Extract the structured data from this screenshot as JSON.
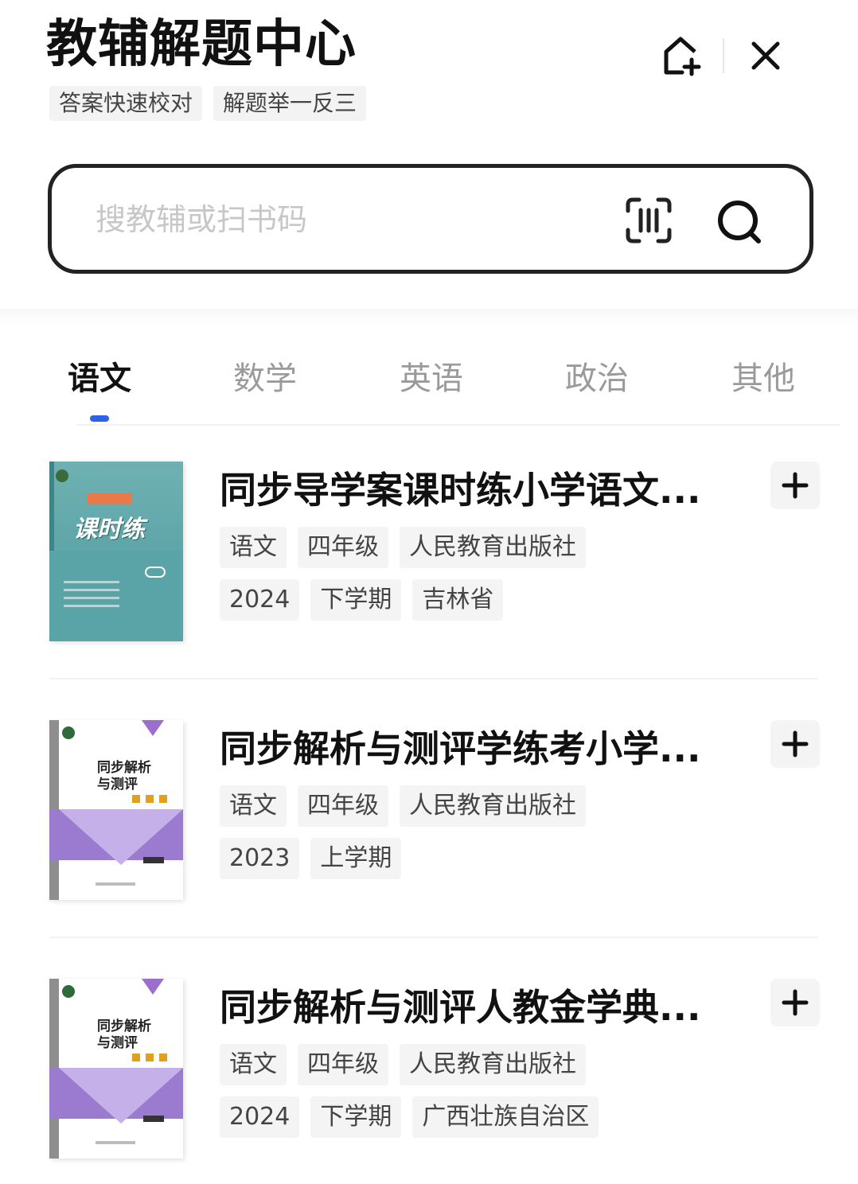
{
  "header": {
    "title": "教辅解题中心",
    "tags": [
      "答案快速校对",
      "解题举一反三"
    ],
    "icons": [
      "add-to-home-icon",
      "close-icon"
    ]
  },
  "search": {
    "placeholder": "搜教辅或扫书码",
    "value": "",
    "icons": [
      "scan-barcode-icon",
      "search-icon"
    ]
  },
  "tabs": [
    {
      "label": "语文",
      "active": true
    },
    {
      "label": "数学",
      "active": false
    },
    {
      "label": "英语",
      "active": false
    },
    {
      "label": "政治",
      "active": false
    },
    {
      "label": "其他",
      "active": false
    }
  ],
  "colors": {
    "accent": "#2a63e6",
    "text": "#111111",
    "muted": "#9a9a9a",
    "tag_bg": "#f4f4f4"
  },
  "books": [
    {
      "title": "同步导学案课时练小学语文...",
      "cover": "teal",
      "cover_title": "课时练",
      "tags_row1": [
        "语文",
        "四年级",
        "人民教育出版社"
      ],
      "tags_row2": [
        "2024",
        "下学期",
        "吉林省"
      ]
    },
    {
      "title": "同步解析与测评学练考小学...",
      "cover": "purple",
      "cover_title": "同步解析与测评",
      "tags_row1": [
        "语文",
        "四年级",
        "人民教育出版社"
      ],
      "tags_row2": [
        "2023",
        "上学期"
      ]
    },
    {
      "title": "同步解析与测评人教金学典...",
      "cover": "purple",
      "cover_title": "同步解析与测评",
      "tags_row1": [
        "语文",
        "四年级",
        "人民教育出版社"
      ],
      "tags_row2": [
        "2024",
        "下学期",
        "广西壮族自治区"
      ]
    }
  ]
}
